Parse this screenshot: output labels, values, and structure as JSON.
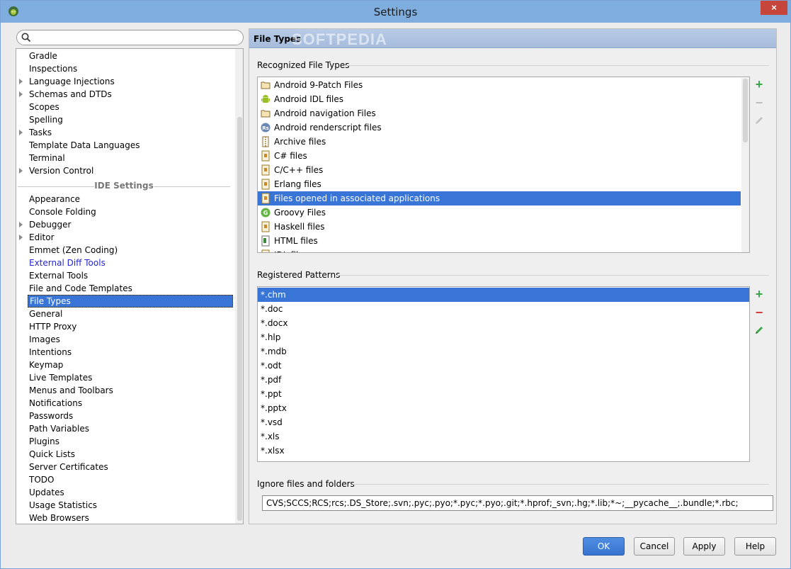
{
  "window": {
    "title": "Settings",
    "close_label": "×"
  },
  "search": {
    "placeholder": ""
  },
  "sidebar": {
    "project_items": [
      {
        "label": "Gradle",
        "arrow": false
      },
      {
        "label": "Inspections",
        "arrow": false
      },
      {
        "label": "Language Injections",
        "arrow": true
      },
      {
        "label": "Schemas and DTDs",
        "arrow": true
      },
      {
        "label": "Scopes",
        "arrow": false
      },
      {
        "label": "Spelling",
        "arrow": false
      },
      {
        "label": "Tasks",
        "arrow": true
      },
      {
        "label": "Template Data Languages",
        "arrow": false
      },
      {
        "label": "Terminal",
        "arrow": false
      },
      {
        "label": "Version Control",
        "arrow": true
      }
    ],
    "ide_separator": "IDE Settings",
    "ide_items": [
      {
        "label": "Appearance",
        "arrow": false
      },
      {
        "label": "Console Folding",
        "arrow": false
      },
      {
        "label": "Debugger",
        "arrow": true
      },
      {
        "label": "Editor",
        "arrow": true
      },
      {
        "label": "Emmet (Zen Coding)",
        "arrow": false
      },
      {
        "label": "External Diff Tools",
        "arrow": false,
        "link": true
      },
      {
        "label": "External Tools",
        "arrow": false
      },
      {
        "label": "File and Code Templates",
        "arrow": false
      },
      {
        "label": "File Types",
        "arrow": false,
        "selected": true
      },
      {
        "label": "General",
        "arrow": false
      },
      {
        "label": "HTTP Proxy",
        "arrow": false
      },
      {
        "label": "Images",
        "arrow": false
      },
      {
        "label": "Intentions",
        "arrow": false
      },
      {
        "label": "Keymap",
        "arrow": false
      },
      {
        "label": "Live Templates",
        "arrow": false
      },
      {
        "label": "Menus and Toolbars",
        "arrow": false
      },
      {
        "label": "Notifications",
        "arrow": false
      },
      {
        "label": "Passwords",
        "arrow": false
      },
      {
        "label": "Path Variables",
        "arrow": false
      },
      {
        "label": "Plugins",
        "arrow": false
      },
      {
        "label": "Quick Lists",
        "arrow": false
      },
      {
        "label": "Server Certificates",
        "arrow": false
      },
      {
        "label": "TODO",
        "arrow": false
      },
      {
        "label": "Updates",
        "arrow": false
      },
      {
        "label": "Usage Statistics",
        "arrow": false
      },
      {
        "label": "Web Browsers",
        "arrow": false
      }
    ]
  },
  "panel": {
    "header": "File Types",
    "watermark": "SOFTPEDIA",
    "recognized_title": "Recognized File Types",
    "file_types": [
      {
        "label": "Android 9-Patch Files",
        "icon": "folder-icon"
      },
      {
        "label": "Android IDL files",
        "icon": "android-icon"
      },
      {
        "label": "Android navigation Files",
        "icon": "folder-icon"
      },
      {
        "label": "Android renderscript files",
        "icon": "renderscript-icon",
        "icon_text": "Rs"
      },
      {
        "label": "Archive files",
        "icon": "archive-icon"
      },
      {
        "label": "C# files",
        "icon": "text-file-icon"
      },
      {
        "label": "C/C++ files",
        "icon": "text-file-icon"
      },
      {
        "label": "Erlang files",
        "icon": "text-file-icon"
      },
      {
        "label": "Files opened in associated applications",
        "icon": "text-file-icon",
        "selected": true
      },
      {
        "label": "Groovy Files",
        "icon": "groovy-icon",
        "icon_text": "G"
      },
      {
        "label": "Haskell files",
        "icon": "text-file-icon"
      },
      {
        "label": "HTML files",
        "icon": "html-file-icon"
      },
      {
        "label": "IDL files",
        "icon": "text-file-icon"
      }
    ],
    "patterns_title": "Registered Patterns",
    "patterns": [
      "*.chm",
      "*.doc",
      "*.docx",
      "*.hlp",
      "*.mdb",
      "*.odt",
      "*.pdf",
      "*.ppt",
      "*.pptx",
      "*.vsd",
      "*.xls",
      "*.xlsx"
    ],
    "selected_pattern": 0,
    "ignore_title": "Ignore files and folders",
    "ignore_value": "CVS;SCCS;RCS;rcs;.DS_Store;.svn;.pyc;.pyo;*.pyc;*.pyo;.git;*.hprof;_svn;.hg;*.lib;*~;__pycache__;.bundle;*.rbc;"
  },
  "tools": {
    "add": "+",
    "remove": "−"
  },
  "buttons": {
    "ok": "OK",
    "cancel": "Cancel",
    "apply": "Apply",
    "help": "Help"
  },
  "colors": {
    "selection": "#3875d7",
    "add": "#3aa64a",
    "remove": "#d33b3b",
    "edit": "#3aa64a",
    "link": "#2424d8"
  }
}
